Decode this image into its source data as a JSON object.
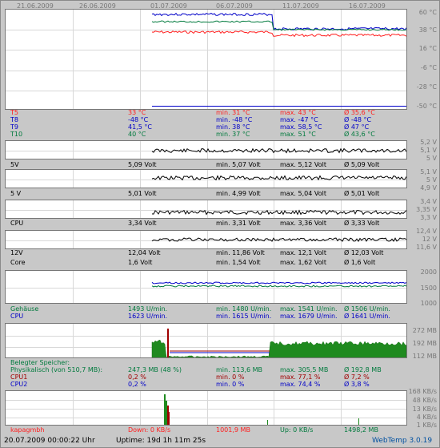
{
  "colors": {
    "red": "#ff2020",
    "blue": "#0000c8",
    "green": "#007a3d",
    "black": "#000000",
    "darkred": "#a00000"
  },
  "dates": [
    "21.06.2009",
    "26.06.2009",
    "01.07.2009",
    "06.07.2009",
    "11.07.2009",
    "16.07.2009"
  ],
  "temp": {
    "axis": [
      "60 °C",
      "38 °C",
      "16 °C",
      "-6 °C",
      "-28 °C",
      "-50 °C"
    ],
    "rows": [
      {
        "label": "T5",
        "value": "33 °C",
        "min": "min. 31 °C",
        "max": "max. 43 °C",
        "avg": "Ø 35,6 °C",
        "color": "red"
      },
      {
        "label": "T8",
        "value": "-48 °C",
        "min": "min. -48 °C",
        "max": "max. -47 °C",
        "avg": "Ø -48 °C",
        "color": "blue"
      },
      {
        "label": "T9",
        "value": "41,5 °C",
        "min": "min. 38 °C",
        "max": "max. 58,5 °C",
        "avg": "Ø 47 °C",
        "color": "blue"
      },
      {
        "label": "T10",
        "value": "40 °C",
        "min": "min. 37 °C",
        "max": "max. 51 °C",
        "avg": "Ø 43,6 °C",
        "color": "green"
      }
    ]
  },
  "volt5a": {
    "axis": [
      "5,2 V",
      "5,1 V",
      "5 V"
    ],
    "row": {
      "label": "5V",
      "value": "5,09 Volt",
      "min": "min. 5,07 Volt",
      "max": "max. 5,12 Volt",
      "avg": "Ø 5,09 Volt"
    }
  },
  "volt5b": {
    "axis": [
      "5,1 V",
      "5 V",
      "4,9 V"
    ],
    "row": {
      "label": "5 V",
      "value": "5,01 Volt",
      "min": "min. 4,99 Volt",
      "max": "max. 5,04 Volt",
      "avg": "Ø 5,01 Volt"
    }
  },
  "voltcpu": {
    "axis": [
      "3,4 V",
      "3,35 V",
      "3,3 V"
    ],
    "row": {
      "label": "CPU",
      "value": "3,34 Volt",
      "min": "min. 3,31 Volt",
      "max": "max. 3,36 Volt",
      "avg": "Ø 3,33 Volt"
    }
  },
  "volt12": {
    "axis": [
      "12,4 V",
      "12 V",
      "11,6 V"
    ],
    "rows": [
      {
        "label": "12V",
        "value": "12,04 Volt",
        "min": "min. 11,86 Volt",
        "max": "max. 12,1 Volt",
        "avg": "Ø 12,03 Volt"
      },
      {
        "label": "Core",
        "value": "1,6 Volt",
        "min": "min. 1,54 Volt",
        "max": "max. 1,62 Volt",
        "avg": "Ø 1,6 Volt"
      }
    ]
  },
  "fan": {
    "axis": [
      "2000",
      "1500",
      "1000"
    ],
    "rows": [
      {
        "label": "Gehäuse",
        "value": "1493 U/min.",
        "min": "min. 1480 U/min.",
        "max": "max. 1541 U/min.",
        "avg": "Ø 1506 U/min.",
        "color": "green"
      },
      {
        "label": "CPU",
        "value": "1623 U/min.",
        "min": "min. 1615 U/min.",
        "max": "max. 1679 U/min.",
        "avg": "Ø 1641 U/min.",
        "color": "blue"
      }
    ]
  },
  "mem": {
    "axis": [
      "272 MB",
      "192 MB",
      "112 MB"
    ],
    "header": "Belegter Speicher:",
    "rows": [
      {
        "label": "Physikalisch (von 510,7 MB):",
        "value": "247,3 MB (48 %)",
        "min": "min. 113,6 MB",
        "max": "max. 305,5 MB",
        "avg": "Ø 192,8 MB",
        "color": "green"
      },
      {
        "label": "CPU1",
        "value": "0,2 %",
        "min": "min. 0 %",
        "max": "max. 77,1 %",
        "avg": "Ø 7,2 %",
        "color": "darkred"
      },
      {
        "label": "CPU2",
        "value": "0,2 %",
        "min": "min. 0 %",
        "max": "max. 74,4 %",
        "avg": "Ø 3,8 %",
        "color": "blue"
      }
    ]
  },
  "net": {
    "axis": [
      "168 KB/s",
      "48 KB/s",
      "13 KB/s",
      "4 KB/s",
      "1 KB/s"
    ],
    "row": {
      "label": "kapagmbh",
      "down": "Down: 0 KB/s",
      "downTotal": "1001,9 MB",
      "up": "Up: 0 KB/s",
      "upTotal": "1498,2 MB"
    }
  },
  "status": {
    "datetime": "20.07.2009 00:00:22 Uhr",
    "uptime": "Uptime: 19d 1h 11m 25s",
    "app": "WebTemp 3.0.19"
  }
}
